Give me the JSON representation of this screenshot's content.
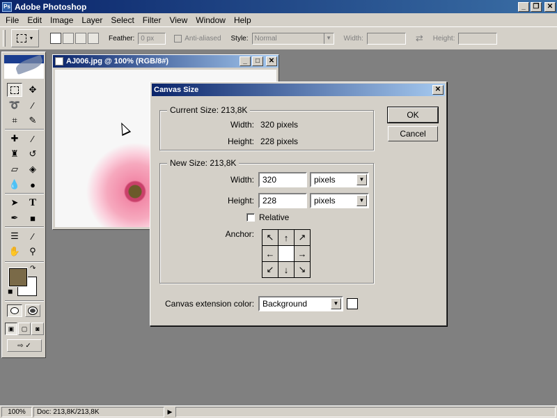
{
  "app": {
    "title": "Adobe Photoshop",
    "icon_label": "Ps"
  },
  "window_buttons": {
    "minimize": "_",
    "restore": "❐",
    "close": "✕"
  },
  "menu": [
    "File",
    "Edit",
    "Image",
    "Layer",
    "Select",
    "Filter",
    "View",
    "Window",
    "Help"
  ],
  "options": {
    "feather_label": "Feather:",
    "feather_value": "0 px",
    "antialiased_label": "Anti-aliased",
    "style_label": "Style:",
    "style_value": "Normal",
    "width_label": "Width:",
    "height_label": "Height:"
  },
  "toolbox": {
    "tools": [
      "marquee",
      "move",
      "lasso",
      "magic-wand",
      "crop",
      "slice",
      "healing-brush",
      "brush",
      "clone-stamp",
      "history-brush",
      "eraser",
      "paint-bucket",
      "blur",
      "dodge",
      "path-selection",
      "type",
      "pen",
      "rectangle",
      "notes",
      "eyedropper",
      "hand",
      "zoom"
    ],
    "foreground_color": "#7a6a48",
    "background_color": "#ffffff"
  },
  "document": {
    "title": "AJ006.jpg @ 100% (RGB/8#)"
  },
  "dialog": {
    "title": "Canvas Size",
    "current_size": {
      "label": "Current Size: 213,8K",
      "width_label": "Width:",
      "width_value": "320 pixels",
      "height_label": "Height:",
      "height_value": "228 pixels"
    },
    "new_size": {
      "label": "New Size: 213,8K",
      "width_label": "Width:",
      "width_value": "320",
      "width_unit": "pixels",
      "height_label": "Height:",
      "height_value": "228",
      "height_unit": "pixels",
      "relative_label": "Relative",
      "anchor_label": "Anchor:",
      "anchor_arrows": [
        "↖",
        "↑",
        "↗",
        "←",
        "",
        "→",
        "↙",
        "↓",
        "↘"
      ]
    },
    "extension_label": "Canvas extension color:",
    "extension_value": "Background",
    "ok_label": "OK",
    "cancel_label": "Cancel"
  },
  "status": {
    "zoom": "100%",
    "doc_info": "Doc: 213,8K/213,8K",
    "arrow": "▶"
  }
}
